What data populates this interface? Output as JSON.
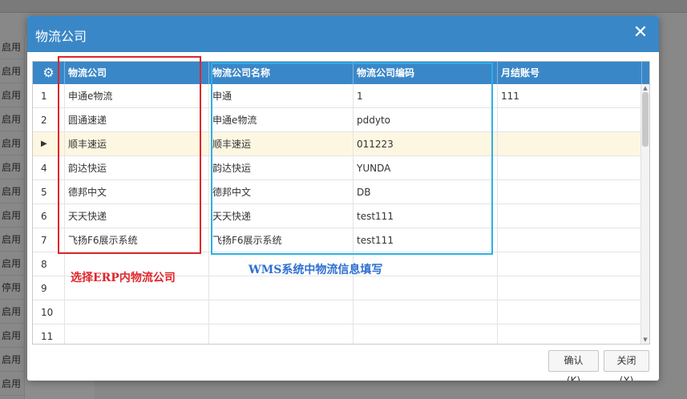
{
  "background": {
    "status_items": [
      "启用",
      "启用",
      "启用",
      "启用",
      "启用",
      "启用",
      "启用",
      "启用",
      "启用",
      "启用",
      "停用",
      "启用",
      "启用",
      "启用",
      "启用"
    ]
  },
  "dialog": {
    "title": "物流公司",
    "close_glyph": "✕"
  },
  "grid": {
    "settings_glyph": "⚙",
    "columns": [
      "物流公司",
      "物流公司名称",
      "物流公司编码",
      "月结账号"
    ],
    "rows": [
      {
        "num": "1",
        "company": "申通e物流",
        "name": "申通",
        "code": "1",
        "account": "111"
      },
      {
        "num": "2",
        "company": "圆通速递",
        "name": "申通e物流",
        "code": "pddyto",
        "account": ""
      },
      {
        "num": "▶",
        "company": "顺丰速运",
        "name": "顺丰速运",
        "code": "011223",
        "account": ""
      },
      {
        "num": "4",
        "company": "韵达快运",
        "name": "韵达快运",
        "code": "YUNDA",
        "account": ""
      },
      {
        "num": "5",
        "company": "德邦中文",
        "name": "德邦中文",
        "code": "DB",
        "account": ""
      },
      {
        "num": "6",
        "company": "天天快递",
        "name": "天天快递",
        "code": "test111",
        "account": ""
      },
      {
        "num": "7",
        "company": "飞扬F6展示系统",
        "name": "飞扬F6展示系统",
        "code": "test111",
        "account": ""
      },
      {
        "num": "8",
        "company": "",
        "name": "",
        "code": "",
        "account": ""
      },
      {
        "num": "9",
        "company": "",
        "name": "",
        "code": "",
        "account": ""
      },
      {
        "num": "10",
        "company": "",
        "name": "",
        "code": "",
        "account": ""
      },
      {
        "num": "11",
        "company": "",
        "name": "",
        "code": "",
        "account": ""
      }
    ],
    "scroll_up_glyph": "▲",
    "scroll_down_glyph": "▼"
  },
  "annotations": {
    "red_note": "选择ERP内物流公司",
    "blue_note": "WMS系统中物流信息填写"
  },
  "footer": {
    "confirm_label": "确认(K)",
    "close_label": "关闭(X)"
  },
  "colors": {
    "header_blue": "#3a87c8",
    "selected_row": "#fdf7e2",
    "annotation_red": "#e0262b",
    "annotation_blue": "#2bb0e5"
  }
}
